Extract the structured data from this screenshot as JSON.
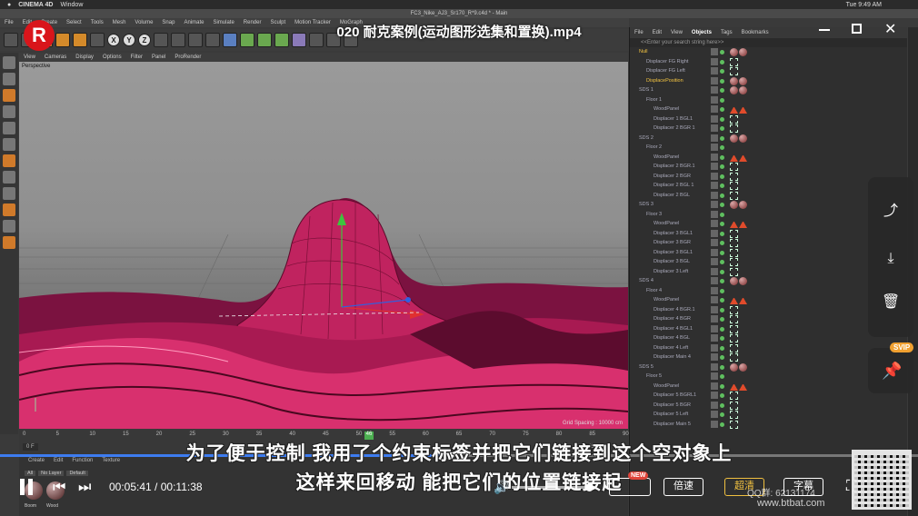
{
  "menubar": {
    "app_name": "CINEMA 4D",
    "window_menu": "Window",
    "clock": "Tue 9:49 AM"
  },
  "c4d": {
    "window_title": "FC3_Nike_AJ3_Sr170_R*9.c4d * - Main",
    "menu": [
      "File",
      "Edit",
      "Create",
      "Select",
      "Tools",
      "Mesh",
      "Volume",
      "Snap",
      "Animate",
      "Simulate",
      "Render",
      "Sculpt",
      "Motion Tracker",
      "MoGraph"
    ],
    "viewport_menu": [
      "View",
      "Cameras",
      "Display",
      "Options",
      "Filter",
      "Panel",
      "ProRender"
    ],
    "viewport_label": "Perspective",
    "grid_spacing": "Grid Spacing : 10000 cm",
    "timeline": {
      "ticks": [
        "0",
        "5",
        "10",
        "15",
        "20",
        "25",
        "30",
        "35",
        "40",
        "45",
        "50",
        "55",
        "60",
        "65",
        "70",
        "75",
        "80",
        "85",
        "90"
      ],
      "current_frame": "46",
      "start_frame": "0 F",
      "end_frame": "45 F"
    },
    "bottom_manager": {
      "tabs": [
        "Create",
        "Edit",
        "Function",
        "Texture"
      ],
      "layers": [
        "All",
        "No Layer",
        "Default"
      ],
      "materials": [
        "Boom",
        "Wood"
      ]
    }
  },
  "object_manager": {
    "menu": [
      "File",
      "Edit",
      "View",
      "Objects",
      "Tags",
      "Bookmarks"
    ],
    "active_menu": "Objects",
    "search_placeholder": "<<Enter your search string here>>",
    "rows": [
      {
        "name": "Null",
        "indent": 0,
        "selected": true,
        "kind": "null"
      },
      {
        "name": "Displacer FG Right",
        "indent": 1,
        "kind": "disp"
      },
      {
        "name": "Displacer FG Left",
        "indent": 1,
        "kind": "disp"
      },
      {
        "name": "DisplacePosition",
        "indent": 1,
        "selected": true,
        "kind": "null"
      },
      {
        "name": "SDS 1",
        "indent": 0,
        "kind": "sds"
      },
      {
        "name": "Floor 1",
        "indent": 1,
        "kind": "floor"
      },
      {
        "name": "WoodPanel",
        "indent": 2,
        "kind": "panel"
      },
      {
        "name": "Displacer 1 BGL1",
        "indent": 2,
        "kind": "disp"
      },
      {
        "name": "Displacer 2 BGR 1",
        "indent": 2,
        "kind": "disp"
      },
      {
        "name": "SDS 2",
        "indent": 0,
        "kind": "sds"
      },
      {
        "name": "Floor 2",
        "indent": 1,
        "kind": "floor"
      },
      {
        "name": "WoodPanel",
        "indent": 2,
        "kind": "panel"
      },
      {
        "name": "Displacer 2 BGR.1",
        "indent": 2,
        "kind": "disp"
      },
      {
        "name": "Displacer 2 BGR",
        "indent": 2,
        "kind": "disp"
      },
      {
        "name": "Displacer 2 BGL 1",
        "indent": 2,
        "kind": "disp"
      },
      {
        "name": "Displacer 2 BGL",
        "indent": 2,
        "kind": "disp"
      },
      {
        "name": "SDS 3",
        "indent": 0,
        "kind": "sds"
      },
      {
        "name": "Floor 3",
        "indent": 1,
        "kind": "floor"
      },
      {
        "name": "WoodPanel",
        "indent": 2,
        "kind": "panel"
      },
      {
        "name": "Displacer 3 BGL1",
        "indent": 2,
        "kind": "disp"
      },
      {
        "name": "Displacer 3 BGR",
        "indent": 2,
        "kind": "disp"
      },
      {
        "name": "Displacer 3 BGL1",
        "indent": 2,
        "kind": "disp"
      },
      {
        "name": "Displacer 3 BGL",
        "indent": 2,
        "kind": "disp"
      },
      {
        "name": "Displacer 3 Left",
        "indent": 2,
        "kind": "disp"
      },
      {
        "name": "SDS 4",
        "indent": 0,
        "kind": "sds"
      },
      {
        "name": "Floor 4",
        "indent": 1,
        "kind": "floor"
      },
      {
        "name": "WoodPanel",
        "indent": 2,
        "kind": "panel"
      },
      {
        "name": "Displacer 4 BGR.1",
        "indent": 2,
        "kind": "disp"
      },
      {
        "name": "Displacer 4 BGR",
        "indent": 2,
        "kind": "disp"
      },
      {
        "name": "Displacer 4 BGL1",
        "indent": 2,
        "kind": "disp"
      },
      {
        "name": "Displacer 4 BGL",
        "indent": 2,
        "kind": "disp"
      },
      {
        "name": "Displacer 4 Left",
        "indent": 2,
        "kind": "disp"
      },
      {
        "name": "Displacer Main 4",
        "indent": 2,
        "kind": "disp"
      },
      {
        "name": "SDS 5",
        "indent": 0,
        "kind": "sds"
      },
      {
        "name": "Floor 5",
        "indent": 1,
        "kind": "floor"
      },
      {
        "name": "WoodPanel",
        "indent": 2,
        "kind": "panel"
      },
      {
        "name": "Displacer 5 BGRL1",
        "indent": 2,
        "kind": "disp"
      },
      {
        "name": "Displacer 5 BGR",
        "indent": 2,
        "kind": "disp"
      },
      {
        "name": "Displacer 5 Left",
        "indent": 2,
        "kind": "disp"
      },
      {
        "name": "Displacer Main 5",
        "indent": 2,
        "kind": "disp"
      }
    ]
  },
  "player": {
    "video_title": "020 耐克案例(运动图形选集和置换).mp4",
    "logo_letter": "R",
    "subtitle_line1": "为了便于控制 我用了个约束标签并把它们链接到这个空对象上",
    "subtitle_line2": "这样来回移动 能把它们的位置链接起",
    "time_current": "00:05:41",
    "time_sep": " / ",
    "time_total": "00:11:38",
    "progress_fraction": 0.489,
    "speed_button": "倍速",
    "quality_button": "超清",
    "subtitle_button": "字幕",
    "new_badge": "NEW",
    "svip_badge": "SVIP",
    "watermark_line1": "QQ群: 62131174",
    "watermark_line2": "www.btbat.com",
    "accent_color": "#3d7cf0",
    "logo_color": "#d9151b"
  }
}
